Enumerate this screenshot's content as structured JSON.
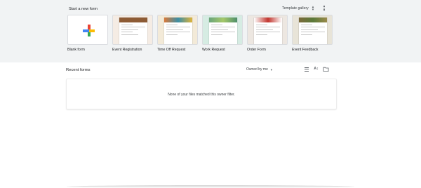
{
  "start": {
    "title": "Start a new form",
    "gallery_label": "Template gallery",
    "gallery_icon": "unfold-more-icon",
    "more_icon": "more-vert-icon"
  },
  "templates": [
    {
      "label": "Blank form",
      "type": "blank"
    },
    {
      "label": "Event Registration",
      "banner": "#8d5b35",
      "bg": "#f5ece4"
    },
    {
      "label": "Time Off Request",
      "banner": "#d9793a",
      "bg": "#f3ead8"
    },
    {
      "label": "Work Request",
      "banner": "#6aa57a",
      "bg": "#d6ece3"
    },
    {
      "label": "Order Form",
      "banner": "#c2362f",
      "bg": "#ede7e1"
    },
    {
      "label": "Event Feedback",
      "banner": "#7b6a3a",
      "bg": "#e8e4d8"
    }
  ],
  "recent": {
    "title": "Recent forms",
    "owner_filter": "Owned by me",
    "empty_message": "None of your files matched this owner filter.",
    "icons": [
      "list-view-icon",
      "sort-az-icon",
      "folder-icon"
    ]
  }
}
